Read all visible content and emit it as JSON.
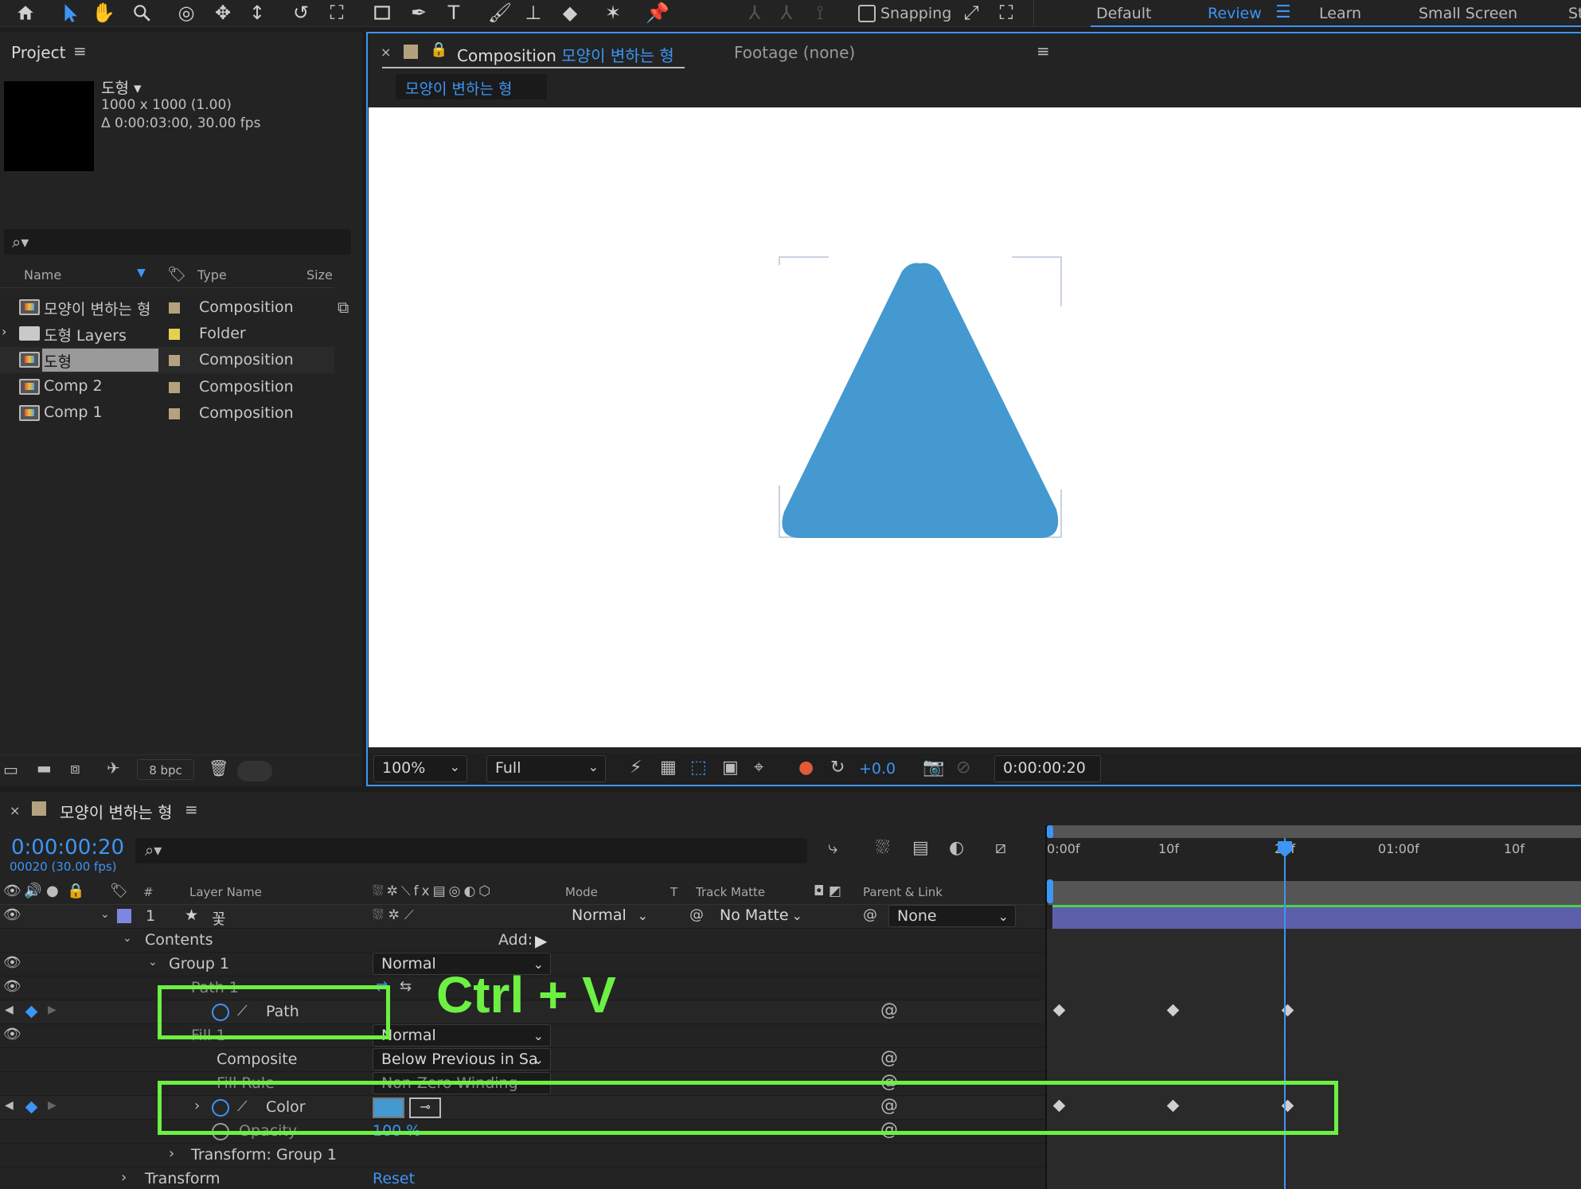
{
  "toolbar": {
    "snapping_label": "Snapping",
    "workspaces": [
      "Default",
      "Review",
      "Learn",
      "Small Screen",
      "St"
    ],
    "active_workspace": "Review"
  },
  "project": {
    "tab_label": "Project",
    "selected_item": {
      "name": "도형 ▾",
      "dimensions": "1000 x 1000 (1.00)",
      "duration": "Δ 0:00:03:00, 30.00 fps"
    },
    "columns": {
      "name": "Name",
      "type": "Type",
      "size": "Size"
    },
    "items": [
      {
        "name": "모양이 변하는 형",
        "type": "Composition",
        "kind": "comp",
        "color": "#b4a27f"
      },
      {
        "name": "도형 Layers",
        "type": "Folder",
        "kind": "folder",
        "color": "#e4d24e"
      },
      {
        "name": "도형",
        "type": "Composition",
        "kind": "comp",
        "color": "#b4a27f"
      },
      {
        "name": "Comp 2",
        "type": "Composition",
        "kind": "comp",
        "color": "#b4a27f"
      },
      {
        "name": "Comp 1",
        "type": "Composition",
        "kind": "comp",
        "color": "#b4a27f"
      }
    ],
    "bpc_label": "8 bpc"
  },
  "viewer": {
    "tab_prefix": "Composition",
    "comp_name": "모양이 변하는 형",
    "footage_tab": "Footage (none)",
    "breadcrumb": "모양이 변하는 형",
    "zoom": "100%",
    "resolution": "Full",
    "exposure": "+0.0",
    "timecode": "0:00:00:20",
    "shape_color": "#4499d0"
  },
  "timeline": {
    "comp_name": "모양이 변하는 형",
    "current_time": "0:00:00:20",
    "frame_info": "00020 (30.00 fps)",
    "columns": {
      "num": "#",
      "layer_name": "Layer Name",
      "mode": "Mode",
      "t": "T",
      "track_matte": "Track Matte",
      "parent": "Parent & Link"
    },
    "ruler": [
      "0:00f",
      "10f",
      "20f",
      "01:00f",
      "10f"
    ],
    "layer": {
      "num": "1",
      "name": "꽃",
      "mode": "Normal",
      "matte": "No Matte",
      "parent": "None"
    },
    "rows": {
      "contents": "Contents",
      "add": "Add:",
      "group1": "Group 1",
      "group1_mode": "Normal",
      "path1": "Path 1",
      "path": "Path",
      "fill1": "Fill 1",
      "fill_mode": "Normal",
      "composite": "Composite",
      "composite_value": "Below Previous in Sa",
      "fill_rule": "Fill Rule",
      "fill_rule_value": "Non-Zero Winding",
      "color": "Color",
      "opacity": "Opacity",
      "opacity_value": "100 %",
      "transform_group": "Transform: Group 1",
      "transform": "Transform",
      "reset": "Reset"
    },
    "fill_color": "#4499d0"
  },
  "annotation": {
    "text": "Ctrl + V",
    "color": "#6cf043"
  }
}
